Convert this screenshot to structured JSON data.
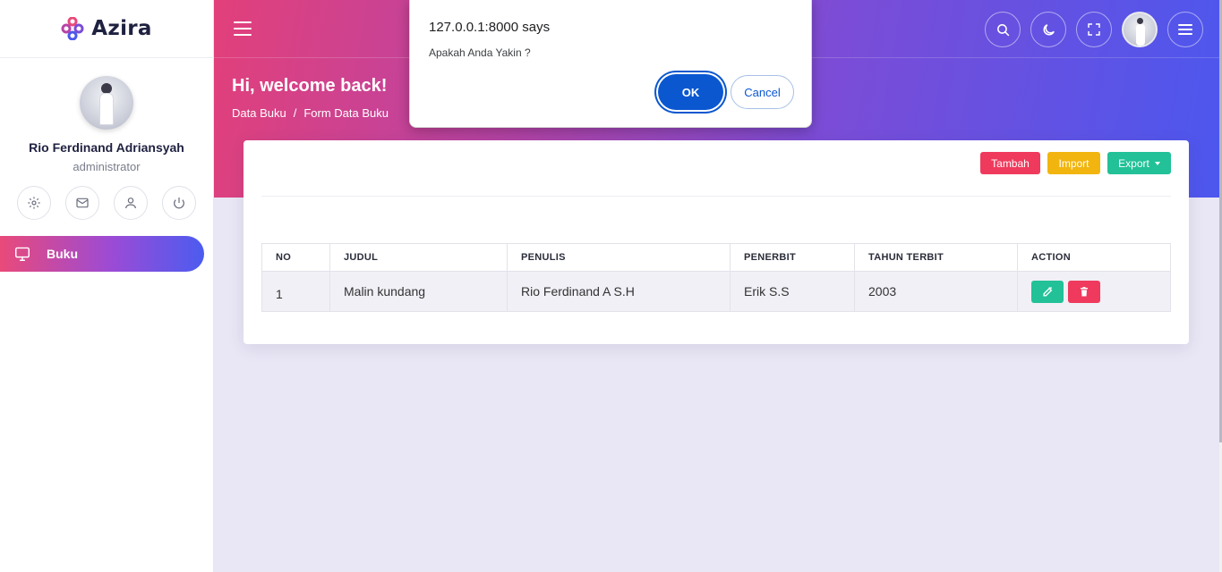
{
  "brand": {
    "name": "Azira"
  },
  "profile": {
    "name": "Rio Ferdinand Adriansyah",
    "role": "administrator"
  },
  "quick_icons": [
    "gear-icon",
    "mail-icon",
    "user-icon",
    "power-icon"
  ],
  "nav": {
    "items": [
      {
        "label": "Buku",
        "icon": "monitor-icon",
        "active": true
      }
    ]
  },
  "header": {
    "welcome": "Hi, welcome back!",
    "breadcrumb": [
      "Data Buku",
      "/",
      "Form Data Buku"
    ],
    "icons": [
      "search-icon",
      "moon-icon",
      "fullscreen-icon",
      "avatar",
      "menu-icon"
    ]
  },
  "card": {
    "buttons": {
      "add": "Tambah",
      "import": "Import",
      "export": "Export"
    }
  },
  "table": {
    "columns": [
      "NO",
      "JUDUL",
      "PENULIS",
      "PENERBIT",
      "TAHUN TERBIT",
      "ACTION"
    ],
    "rows": [
      {
        "no": "1",
        "judul": "Malin kundang",
        "penulis": "Rio Ferdinand A S.H",
        "penerbit": "Erik S.S",
        "tahun": "2003"
      }
    ]
  },
  "dialog": {
    "title": "127.0.0.1:8000 says",
    "message": "Apakah Anda Yakin ?",
    "ok": "OK",
    "cancel": "Cancel"
  },
  "colors": {
    "accent_pink": "#e2407a",
    "accent_blue": "#4c57ee",
    "danger": "#ef3a5d",
    "warning": "#f2b50f",
    "success": "#22c197",
    "dialog_primary": "#0b57d0"
  }
}
